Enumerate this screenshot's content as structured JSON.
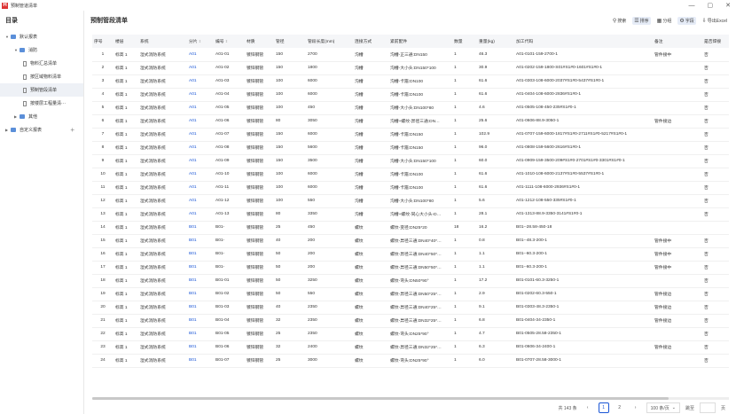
{
  "window": {
    "title": "预制管道清单"
  },
  "sidebar": {
    "title": "目录",
    "items": [
      {
        "label": "默认报表",
        "level": 0,
        "kind": "folder",
        "expanded": true
      },
      {
        "label": "消防",
        "level": 1,
        "kind": "folder",
        "expanded": true
      },
      {
        "label": "物料汇总清单",
        "level": 2,
        "kind": "doc"
      },
      {
        "label": "按区域物料清单",
        "level": 2,
        "kind": "doc"
      },
      {
        "label": "预制管段清单",
        "level": 2,
        "kind": "doc",
        "selected": true
      },
      {
        "label": "按楼层工程量清···",
        "level": 2,
        "kind": "doc"
      },
      {
        "label": "其他",
        "level": 1,
        "kind": "folder",
        "expanded": false
      },
      {
        "label": "自定义报表",
        "level": 0,
        "kind": "folder",
        "expanded": false,
        "plus": "+"
      }
    ]
  },
  "main": {
    "title": "预制管段清单"
  },
  "toolbar": {
    "search": "搜索",
    "sort": "排序",
    "group": "分组",
    "fields": "字段",
    "export": "导出Excel"
  },
  "table": {
    "columns": [
      "序号",
      "楼层",
      "系统",
      "分片",
      "编号",
      "材质",
      "管径",
      "管段长度(mm)",
      "连接方式",
      "紧前配件",
      "数量",
      "重量(kg)",
      "加工代码",
      "备注",
      "是否焊接"
    ],
    "rows": [
      [
        "1",
        "标高 1",
        "湿式消防系统",
        "A01",
        "A01-01",
        "镀锌钢管",
        "150",
        "2700",
        "沟槽",
        "沟槽-正三通:DN150",
        "1",
        "46.3",
        "A01-0101-159-2700-1",
        "管件接中",
        "否"
      ],
      [
        "2",
        "标高 1",
        "湿式消防系统",
        "A01",
        "A01-02",
        "镀锌钢管",
        "150",
        "1800",
        "沟槽",
        "沟槽-大小头:DN150*100",
        "1",
        "30.9",
        "A01-0202-159-1800-S01#S1#0-1601#S1#0-1",
        "",
        "否"
      ],
      [
        "3",
        "标高 1",
        "湿式消防系统",
        "A01",
        "A01-03",
        "镀锌钢管",
        "100",
        "6000",
        "沟槽",
        "沟槽-卡箍:DN100",
        "1",
        "61.6",
        "A01-0303-108-6000-2037#S1#0-5437#S1#0-1",
        "",
        "否"
      ],
      [
        "4",
        "标高 1",
        "湿式消防系统",
        "A01",
        "A01-04",
        "镀锌钢管",
        "100",
        "6000",
        "沟槽",
        "沟槽-卡箍:DN100",
        "1",
        "61.6",
        "A01-0404-108-6000-2836#S1#0-1",
        "",
        "否"
      ],
      [
        "5",
        "标高 1",
        "湿式消防系统",
        "A01",
        "A01-05",
        "镀锌钢管",
        "100",
        "450",
        "沟槽",
        "沟槽-大小头:DN100*80",
        "1",
        "4.6",
        "A01-0505-108-450-235#S1#0-1",
        "",
        "否"
      ],
      [
        "6",
        "标高 1",
        "湿式消防系统",
        "A01",
        "A01-06",
        "镀锌钢管",
        "80",
        "3050",
        "沟槽",
        "沟槽+螺纹-异径三通:DN…",
        "1",
        "25.6",
        "A01-0606-88.9-3050-1",
        "管件接边",
        "否"
      ],
      [
        "7",
        "标高 1",
        "湿式消防系统",
        "A01",
        "A01-07",
        "镀锌钢管",
        "150",
        "6000",
        "沟槽",
        "沟槽-卡箍:DN150",
        "1",
        "102.9",
        "A01-0707-159-6000-1817#S1#0-2711#S1#0-5217#S1#0-1",
        "",
        "否"
      ],
      [
        "8",
        "标高 1",
        "湿式消防系统",
        "A01",
        "A01-08",
        "镀锌钢管",
        "150",
        "5600",
        "沟槽",
        "沟槽-卡箍:DN150",
        "1",
        "96.0",
        "A01-0808-159-5600-2616#S1#0-1",
        "",
        "否"
      ],
      [
        "9",
        "标高 1",
        "湿式消防系统",
        "A01",
        "A01-09",
        "镀锌钢管",
        "150",
        "3500",
        "沟槽",
        "沟槽-大小头:DN150*100",
        "1",
        "60.0",
        "A01-0909-159-3500-209#S1#0-2701#S1#0-3301#S1#0-1",
        "",
        "否"
      ],
      [
        "10",
        "标高 1",
        "湿式消防系统",
        "A01",
        "A01-10",
        "镀锌钢管",
        "100",
        "6000",
        "沟槽",
        "沟槽-卡箍:DN100",
        "1",
        "61.6",
        "A01-1010-108-6000-2137#S1#0-5537#S1#0-1",
        "",
        "否"
      ],
      [
        "11",
        "标高 1",
        "湿式消防系统",
        "A01",
        "A01-11",
        "镀锌钢管",
        "100",
        "6000",
        "沟槽",
        "沟槽-卡箍:DN100",
        "1",
        "61.6",
        "A01-1111-108-6000-2936#S1#0-1",
        "",
        "否"
      ],
      [
        "12",
        "标高 1",
        "湿式消防系统",
        "A01",
        "A01-12",
        "镀锌钢管",
        "100",
        "550",
        "沟槽",
        "沟槽-大小头:DN100*80",
        "1",
        "5.6",
        "A01-1212-108-550-335#S1#0-1",
        "",
        "否"
      ],
      [
        "13",
        "标高 1",
        "湿式消防系统",
        "A01",
        "A01-13",
        "镀锌钢管",
        "80",
        "3350",
        "沟槽",
        "沟槽+螺纹-同心大小头-D…",
        "1",
        "28.1",
        "A01-1313-88.9-3350-3141#S1#0-1",
        "",
        "否"
      ],
      [
        "14",
        "标高 1",
        "湿式消防系统",
        "B01",
        "B01-",
        "镀锌钢管",
        "25",
        "450",
        "螺纹",
        "螺纹-变径:DN25*20",
        "18",
        "16.2",
        "B01--28.58-450-18",
        "",
        ""
      ],
      [
        "15",
        "标高 1",
        "湿式消防系统",
        "B01",
        "B01-",
        "镀锌钢管",
        "40",
        "200",
        "螺纹",
        "螺纹-异径三通:DN40*40*…",
        "1",
        "0.8",
        "B01--48.3-200-1",
        "管件接中",
        "否"
      ],
      [
        "16",
        "标高 1",
        "湿式消防系统",
        "B01",
        "B01-",
        "镀锌钢管",
        "50",
        "200",
        "螺纹",
        "螺纹-异径三通:DN40*50*…",
        "1",
        "1.1",
        "B01--60.3-200-1",
        "管件接中",
        "否"
      ],
      [
        "17",
        "标高 1",
        "湿式消防系统",
        "B01",
        "B01-",
        "镀锌钢管",
        "50",
        "200",
        "螺纹",
        "螺纹-异径三通:DN50*50*…",
        "1",
        "1.1",
        "B01--60.3-200-1",
        "管件接中",
        "否"
      ],
      [
        "18",
        "标高 1",
        "湿式消防系统",
        "B01",
        "B01-01",
        "镀锌钢管",
        "50",
        "3250",
        "螺纹",
        "螺纹-弯头:DN50*90°",
        "1",
        "17.2",
        "B01-0101-60.3-3250-1",
        "",
        "否"
      ],
      [
        "19",
        "标高 1",
        "湿式消防系统",
        "B01",
        "B01-02",
        "镀锌钢管",
        "50",
        "550",
        "螺纹",
        "螺纹-异径三通:DN50*25*…",
        "1",
        "2.9",
        "B01-0202-60.3-550-1",
        "管件接边",
        "否"
      ],
      [
        "20",
        "标高 1",
        "湿式消防系统",
        "B01",
        "B01-03",
        "镀锌钢管",
        "40",
        "2350",
        "螺纹",
        "螺纹-异径三通:DN40*25*…",
        "1",
        "9.1",
        "B01-0303-48.3-2350-1",
        "管件接边",
        "否"
      ],
      [
        "21",
        "标高 1",
        "湿式消防系统",
        "B01",
        "B01-04",
        "镀锌钢管",
        "32",
        "2350",
        "螺纹",
        "螺纹-异径三通:DN32*25*…",
        "1",
        "6.8",
        "B01-0404-34-2350-1",
        "管件接边",
        "否"
      ],
      [
        "22",
        "标高 1",
        "湿式消防系统",
        "B01",
        "B01-05",
        "镀锌钢管",
        "25",
        "2350",
        "螺纹",
        "螺纹-弯头:DN25*90°",
        "1",
        "4.7",
        "B01-0505-28.58-2350-1",
        "",
        "否"
      ],
      [
        "23",
        "标高 1",
        "湿式消防系统",
        "B01",
        "B01-06",
        "镀锌钢管",
        "32",
        "2400",
        "螺纹",
        "螺纹-异径三通:DN32*25*…",
        "1",
        "6.3",
        "B01-0606-34-2400-1",
        "管件接边",
        "否"
      ],
      [
        "24",
        "标高 1",
        "湿式消防系统",
        "B01",
        "B01-07",
        "镀锌钢管",
        "25",
        "3000",
        "螺纹",
        "螺纹-弯头:DN25*90°",
        "1",
        "6.0",
        "B01-0707-28.58-3000-1",
        "",
        "否"
      ]
    ]
  },
  "pager": {
    "total": "共 143 条",
    "pages": [
      "1",
      "2"
    ],
    "current": "1",
    "size": "100 条/页",
    "jump": "跳至",
    "page_unit": "页"
  }
}
